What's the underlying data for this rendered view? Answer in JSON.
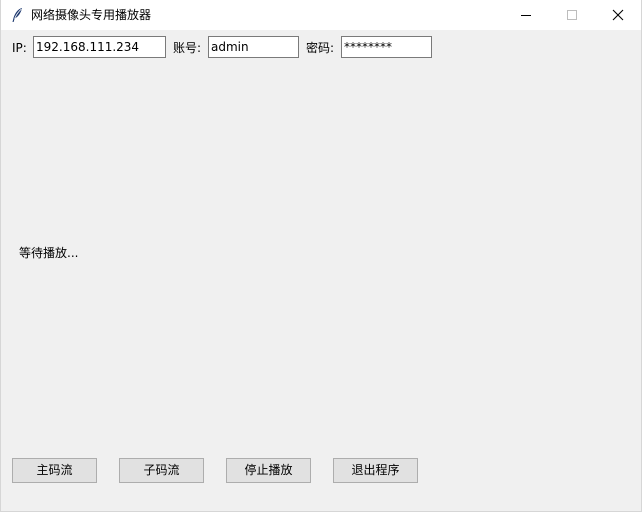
{
  "window": {
    "title": "网络摄像头专用播放器",
    "icon": "feather-icon",
    "controls": [
      "minimize-icon",
      "maximize-icon",
      "close-icon"
    ]
  },
  "connection": {
    "ip_label": "IP:",
    "ip_value": "192.168.111.234",
    "account_label": "账号:",
    "account_value": "admin",
    "password_label": "密码:",
    "password_value": "********"
  },
  "video": {
    "status_text": "等待播放..."
  },
  "buttons": {
    "main_stream": "主码流",
    "sub_stream": "子码流",
    "stop": "停止播放",
    "exit": "退出程序"
  },
  "colors": {
    "window_bg": "#f0f0f0",
    "titlebar_bg": "#ffffff",
    "button_bg": "#e1e1e1",
    "button_border": "#adadad",
    "field_border": "#7a7a7a"
  }
}
